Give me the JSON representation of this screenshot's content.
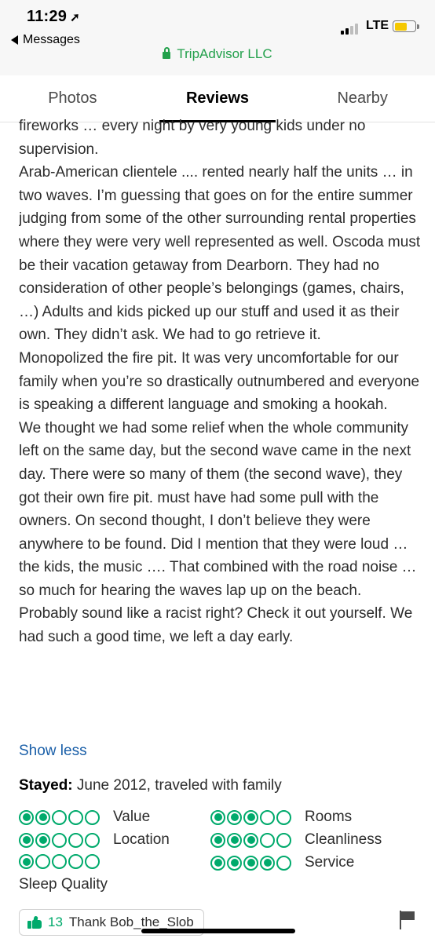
{
  "status_bar": {
    "time": "11:29",
    "back_label": "Messages",
    "network": "LTE"
  },
  "browser": {
    "site_name": "TripAdvisor LLC"
  },
  "tabs": [
    {
      "label": "Photos"
    },
    {
      "label": "Reviews"
    },
    {
      "label": "Nearby"
    }
  ],
  "review": {
    "paragraphs": [
      "fireworks … every night by very young kids under no supervision.",
      "Arab-American clientele .... rented nearly half the units … in two waves. I’m guessing that goes on for the entire summer judging from some of the other surrounding rental properties where they were very well represented as well. Oscoda must be their vacation getaway from Dearborn. They had no consideration of other people’s belongings (games, chairs, …) Adults and kids picked up our stuff and used it as their own. They didn’t ask. We had to go retrieve it.",
      "Monopolized the fire pit. It was very uncomfortable for our family when you’re so drastically outnumbered and everyone is speaking a different language and smoking a hookah.",
      "We thought we had some relief when the whole community left on the same day, but the second wave came in the next day. There were so many of them (the second wave), they got their own fire pit. must have had some pull with the owners. On second thought, I don’t believe they were anywhere to be found. Did I mention that they were loud … the kids, the music …. That combined with the road noise … so much for hearing the waves lap up on the beach.",
      "Probably sound like a racist right? Check it out yourself. We had such a good time, we left a day early."
    ],
    "show_less": "Show less",
    "stayed_label": "Stayed:",
    "stayed_value": "June 2012, traveled with family"
  },
  "ratings": [
    {
      "label": "Value",
      "score": 2,
      "max": 5
    },
    {
      "label": "Rooms",
      "score": 3,
      "max": 5
    },
    {
      "label": "Location",
      "score": 2,
      "max": 5
    },
    {
      "label": "Cleanliness",
      "score": 3,
      "max": 5
    },
    {
      "label": "Sleep Quality",
      "score": 1,
      "max": 5
    },
    {
      "label": "Service",
      "score": 4,
      "max": 5
    }
  ],
  "actions": {
    "thank_count": "13",
    "thank_text": "Thank Bob_the_Slob"
  },
  "colors": {
    "rating_green": "#00aa6c",
    "secure_green": "#22a04b",
    "link_blue": "#1a5fa8"
  }
}
